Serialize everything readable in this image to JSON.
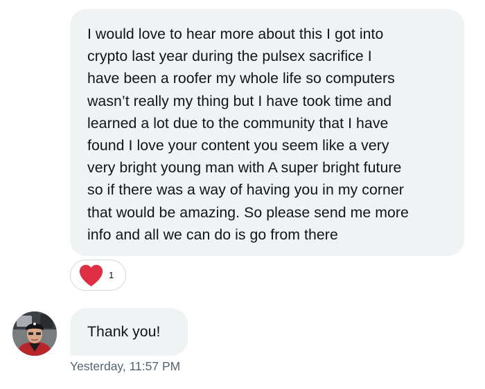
{
  "conversation": {
    "messages": [
      {
        "text": "I would love to hear more about this I got into\ncrypto last year during the pulsex sacrifice I\nhave been a roofer my whole life so computers\nwasn’t really my thing but I have took time and\nlearned a lot due to the community that I have\nfound I love your content you seem like a very\nvery bright young man with A super bright future\nso if there was a way of having you in my corner\nthat would be amazing. So please send me more\ninfo and all we can do is go from there",
        "reaction": {
          "icon": "heart-icon",
          "color": "#f91880",
          "count": "1"
        }
      },
      {
        "text": "Thank you!",
        "timestamp": "Yesterday, 11:57 PM",
        "avatar": "avatar"
      }
    ]
  },
  "colors": {
    "bubble_bg": "#eff3f4",
    "heart_red": "#e0245e",
    "timestamp_gray": "#536471"
  }
}
